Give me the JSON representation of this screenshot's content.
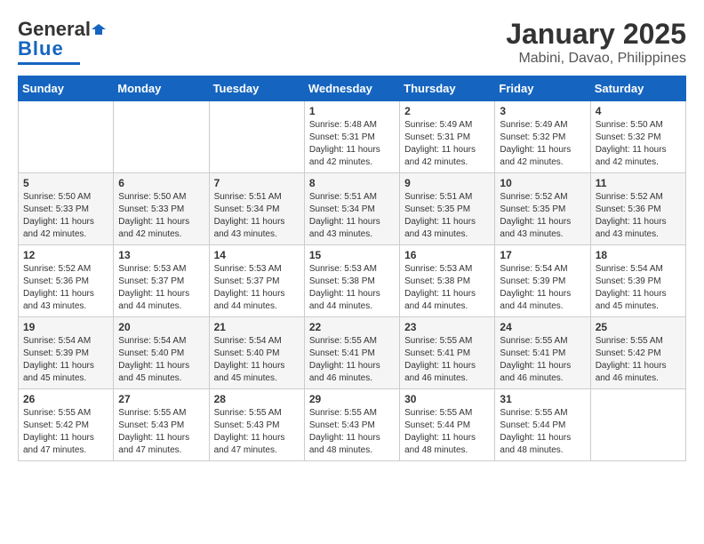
{
  "header": {
    "logo_general": "General",
    "logo_blue": "Blue",
    "title": "January 2025",
    "subtitle": "Mabini, Davao, Philippines"
  },
  "weekdays": [
    "Sunday",
    "Monday",
    "Tuesday",
    "Wednesday",
    "Thursday",
    "Friday",
    "Saturday"
  ],
  "weeks": [
    [
      {
        "day": "",
        "sunrise": "",
        "sunset": "",
        "daylight": ""
      },
      {
        "day": "",
        "sunrise": "",
        "sunset": "",
        "daylight": ""
      },
      {
        "day": "",
        "sunrise": "",
        "sunset": "",
        "daylight": ""
      },
      {
        "day": "1",
        "sunrise": "Sunrise: 5:48 AM",
        "sunset": "Sunset: 5:31 PM",
        "daylight": "Daylight: 11 hours and 42 minutes."
      },
      {
        "day": "2",
        "sunrise": "Sunrise: 5:49 AM",
        "sunset": "Sunset: 5:31 PM",
        "daylight": "Daylight: 11 hours and 42 minutes."
      },
      {
        "day": "3",
        "sunrise": "Sunrise: 5:49 AM",
        "sunset": "Sunset: 5:32 PM",
        "daylight": "Daylight: 11 hours and 42 minutes."
      },
      {
        "day": "4",
        "sunrise": "Sunrise: 5:50 AM",
        "sunset": "Sunset: 5:32 PM",
        "daylight": "Daylight: 11 hours and 42 minutes."
      }
    ],
    [
      {
        "day": "5",
        "sunrise": "Sunrise: 5:50 AM",
        "sunset": "Sunset: 5:33 PM",
        "daylight": "Daylight: 11 hours and 42 minutes."
      },
      {
        "day": "6",
        "sunrise": "Sunrise: 5:50 AM",
        "sunset": "Sunset: 5:33 PM",
        "daylight": "Daylight: 11 hours and 42 minutes."
      },
      {
        "day": "7",
        "sunrise": "Sunrise: 5:51 AM",
        "sunset": "Sunset: 5:34 PM",
        "daylight": "Daylight: 11 hours and 43 minutes."
      },
      {
        "day": "8",
        "sunrise": "Sunrise: 5:51 AM",
        "sunset": "Sunset: 5:34 PM",
        "daylight": "Daylight: 11 hours and 43 minutes."
      },
      {
        "day": "9",
        "sunrise": "Sunrise: 5:51 AM",
        "sunset": "Sunset: 5:35 PM",
        "daylight": "Daylight: 11 hours and 43 minutes."
      },
      {
        "day": "10",
        "sunrise": "Sunrise: 5:52 AM",
        "sunset": "Sunset: 5:35 PM",
        "daylight": "Daylight: 11 hours and 43 minutes."
      },
      {
        "day": "11",
        "sunrise": "Sunrise: 5:52 AM",
        "sunset": "Sunset: 5:36 PM",
        "daylight": "Daylight: 11 hours and 43 minutes."
      }
    ],
    [
      {
        "day": "12",
        "sunrise": "Sunrise: 5:52 AM",
        "sunset": "Sunset: 5:36 PM",
        "daylight": "Daylight: 11 hours and 43 minutes."
      },
      {
        "day": "13",
        "sunrise": "Sunrise: 5:53 AM",
        "sunset": "Sunset: 5:37 PM",
        "daylight": "Daylight: 11 hours and 44 minutes."
      },
      {
        "day": "14",
        "sunrise": "Sunrise: 5:53 AM",
        "sunset": "Sunset: 5:37 PM",
        "daylight": "Daylight: 11 hours and 44 minutes."
      },
      {
        "day": "15",
        "sunrise": "Sunrise: 5:53 AM",
        "sunset": "Sunset: 5:38 PM",
        "daylight": "Daylight: 11 hours and 44 minutes."
      },
      {
        "day": "16",
        "sunrise": "Sunrise: 5:53 AM",
        "sunset": "Sunset: 5:38 PM",
        "daylight": "Daylight: 11 hours and 44 minutes."
      },
      {
        "day": "17",
        "sunrise": "Sunrise: 5:54 AM",
        "sunset": "Sunset: 5:39 PM",
        "daylight": "Daylight: 11 hours and 44 minutes."
      },
      {
        "day": "18",
        "sunrise": "Sunrise: 5:54 AM",
        "sunset": "Sunset: 5:39 PM",
        "daylight": "Daylight: 11 hours and 45 minutes."
      }
    ],
    [
      {
        "day": "19",
        "sunrise": "Sunrise: 5:54 AM",
        "sunset": "Sunset: 5:39 PM",
        "daylight": "Daylight: 11 hours and 45 minutes."
      },
      {
        "day": "20",
        "sunrise": "Sunrise: 5:54 AM",
        "sunset": "Sunset: 5:40 PM",
        "daylight": "Daylight: 11 hours and 45 minutes."
      },
      {
        "day": "21",
        "sunrise": "Sunrise: 5:54 AM",
        "sunset": "Sunset: 5:40 PM",
        "daylight": "Daylight: 11 hours and 45 minutes."
      },
      {
        "day": "22",
        "sunrise": "Sunrise: 5:55 AM",
        "sunset": "Sunset: 5:41 PM",
        "daylight": "Daylight: 11 hours and 46 minutes."
      },
      {
        "day": "23",
        "sunrise": "Sunrise: 5:55 AM",
        "sunset": "Sunset: 5:41 PM",
        "daylight": "Daylight: 11 hours and 46 minutes."
      },
      {
        "day": "24",
        "sunrise": "Sunrise: 5:55 AM",
        "sunset": "Sunset: 5:41 PM",
        "daylight": "Daylight: 11 hours and 46 minutes."
      },
      {
        "day": "25",
        "sunrise": "Sunrise: 5:55 AM",
        "sunset": "Sunset: 5:42 PM",
        "daylight": "Daylight: 11 hours and 46 minutes."
      }
    ],
    [
      {
        "day": "26",
        "sunrise": "Sunrise: 5:55 AM",
        "sunset": "Sunset: 5:42 PM",
        "daylight": "Daylight: 11 hours and 47 minutes."
      },
      {
        "day": "27",
        "sunrise": "Sunrise: 5:55 AM",
        "sunset": "Sunset: 5:43 PM",
        "daylight": "Daylight: 11 hours and 47 minutes."
      },
      {
        "day": "28",
        "sunrise": "Sunrise: 5:55 AM",
        "sunset": "Sunset: 5:43 PM",
        "daylight": "Daylight: 11 hours and 47 minutes."
      },
      {
        "day": "29",
        "sunrise": "Sunrise: 5:55 AM",
        "sunset": "Sunset: 5:43 PM",
        "daylight": "Daylight: 11 hours and 48 minutes."
      },
      {
        "day": "30",
        "sunrise": "Sunrise: 5:55 AM",
        "sunset": "Sunset: 5:44 PM",
        "daylight": "Daylight: 11 hours and 48 minutes."
      },
      {
        "day": "31",
        "sunrise": "Sunrise: 5:55 AM",
        "sunset": "Sunset: 5:44 PM",
        "daylight": "Daylight: 11 hours and 48 minutes."
      },
      {
        "day": "",
        "sunrise": "",
        "sunset": "",
        "daylight": ""
      }
    ]
  ]
}
